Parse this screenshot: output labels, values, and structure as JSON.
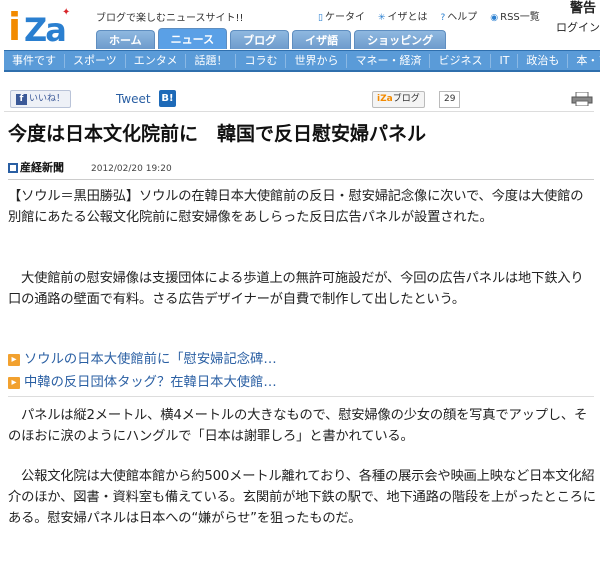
{
  "header": {
    "logo_text": "iZa",
    "tagline": "ブログで楽しむニュースサイト!!",
    "links": [
      {
        "icon": "mobile-icon",
        "label": "ケータイ"
      },
      {
        "icon": "info-icon",
        "label": "イザとは"
      },
      {
        "icon": "help-icon",
        "label": "ヘルプ"
      },
      {
        "icon": "rss-icon",
        "label": "RSS一覧"
      }
    ],
    "warning": "警告",
    "login": "ログイン"
  },
  "main_tabs": [
    "ホーム",
    "ニュース",
    "ブログ",
    "イザ語",
    "ショッピング"
  ],
  "active_tab": "ニュース",
  "nav": [
    "事件です",
    "スポーツ",
    "エンタメ",
    "話題！",
    "コラむ",
    "世界から",
    "マネー・経済",
    "ビジネス",
    "IT",
    "政治も",
    "本・アー"
  ],
  "social": {
    "like_label": "いいね！",
    "tweet_label": "Tweet",
    "hatena_label": "B!",
    "iza_blog_label": "ブログ",
    "iza_blog_count": "29"
  },
  "article": {
    "title": "今度は日本文化院前に　韓国で反日慰安婦パネル",
    "source": "産経新聞",
    "timestamp": "2012/02/20 19:20",
    "paragraphs": [
      "【ソウル＝黒田勝弘】ソウルの在韓日本大使館前の反日・慰安婦記念像に次いで、今度は大使館の別館にあたる公報文化院前に慰安婦像をあしらった反日広告パネルが設置された。",
      "大使館前の慰安婦像は支援団体による歩道上の無許可施設だが、今回の広告パネルは地下鉄入り口の通路の壁面で有料。さる広告デザイナーが自費で制作して出したという。",
      "パネルは縦2メートル、横4メートルの大きなもので、慰安婦像の少女の顔を写真でアップし、そのほおに涙のようにハングルで「日本は謝罪しろ」と書かれている。",
      "公報文化院は大使館本館から約500メートル離れており、各種の展示会や映画上映など日本文化紹介のほか、図書・資料室も備えている。玄関前が地下鉄の駅で、地下通路の階段を上がったところにある。慰安婦パネルは日本への“嫌がらせ”を狙ったものだ。"
    ],
    "related": [
      "ソウルの日本大使館前に「慰安婦記念碑…",
      "中韓の反日団体タッグ？在韓日本大使館…"
    ]
  },
  "colors": {
    "nav_blue": "#5a9bd8",
    "link_blue": "#2a5fa3",
    "logo_orange": "#f28a00",
    "arrow_orange": "#f2a12f"
  }
}
